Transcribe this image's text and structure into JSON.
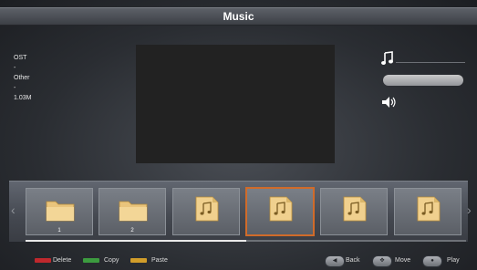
{
  "header": {
    "title": "Music"
  },
  "media_info": {
    "album": "OST",
    "separator1": "-",
    "genre": "Other",
    "separator2": "-",
    "size": "1.03M"
  },
  "playback": {
    "progress": 0.0
  },
  "file_strip": {
    "items": [
      {
        "type": "folder",
        "label": "1"
      },
      {
        "type": "folder",
        "label": "2"
      },
      {
        "type": "music-file",
        "label": ""
      },
      {
        "type": "music-file",
        "label": "",
        "selected": true
      },
      {
        "type": "music-file",
        "label": ""
      },
      {
        "type": "music-file",
        "label": ""
      }
    ],
    "scroll_position": 0.5
  },
  "footer": {
    "delete_label": "Delete",
    "copy_label": "Copy",
    "paste_label": "Paste",
    "back_label": "Back",
    "move_label": "Move",
    "play_label": "Play"
  },
  "colors": {
    "selection_border": "#d06b2a",
    "key_red": "#c0282d",
    "key_green": "#3c9b3f",
    "key_yellow": "#d19d2a"
  },
  "icons": {
    "folder": "folder-icon",
    "music_file": "music-file-icon",
    "note": "music-note-icon",
    "volume": "speaker-icon"
  }
}
